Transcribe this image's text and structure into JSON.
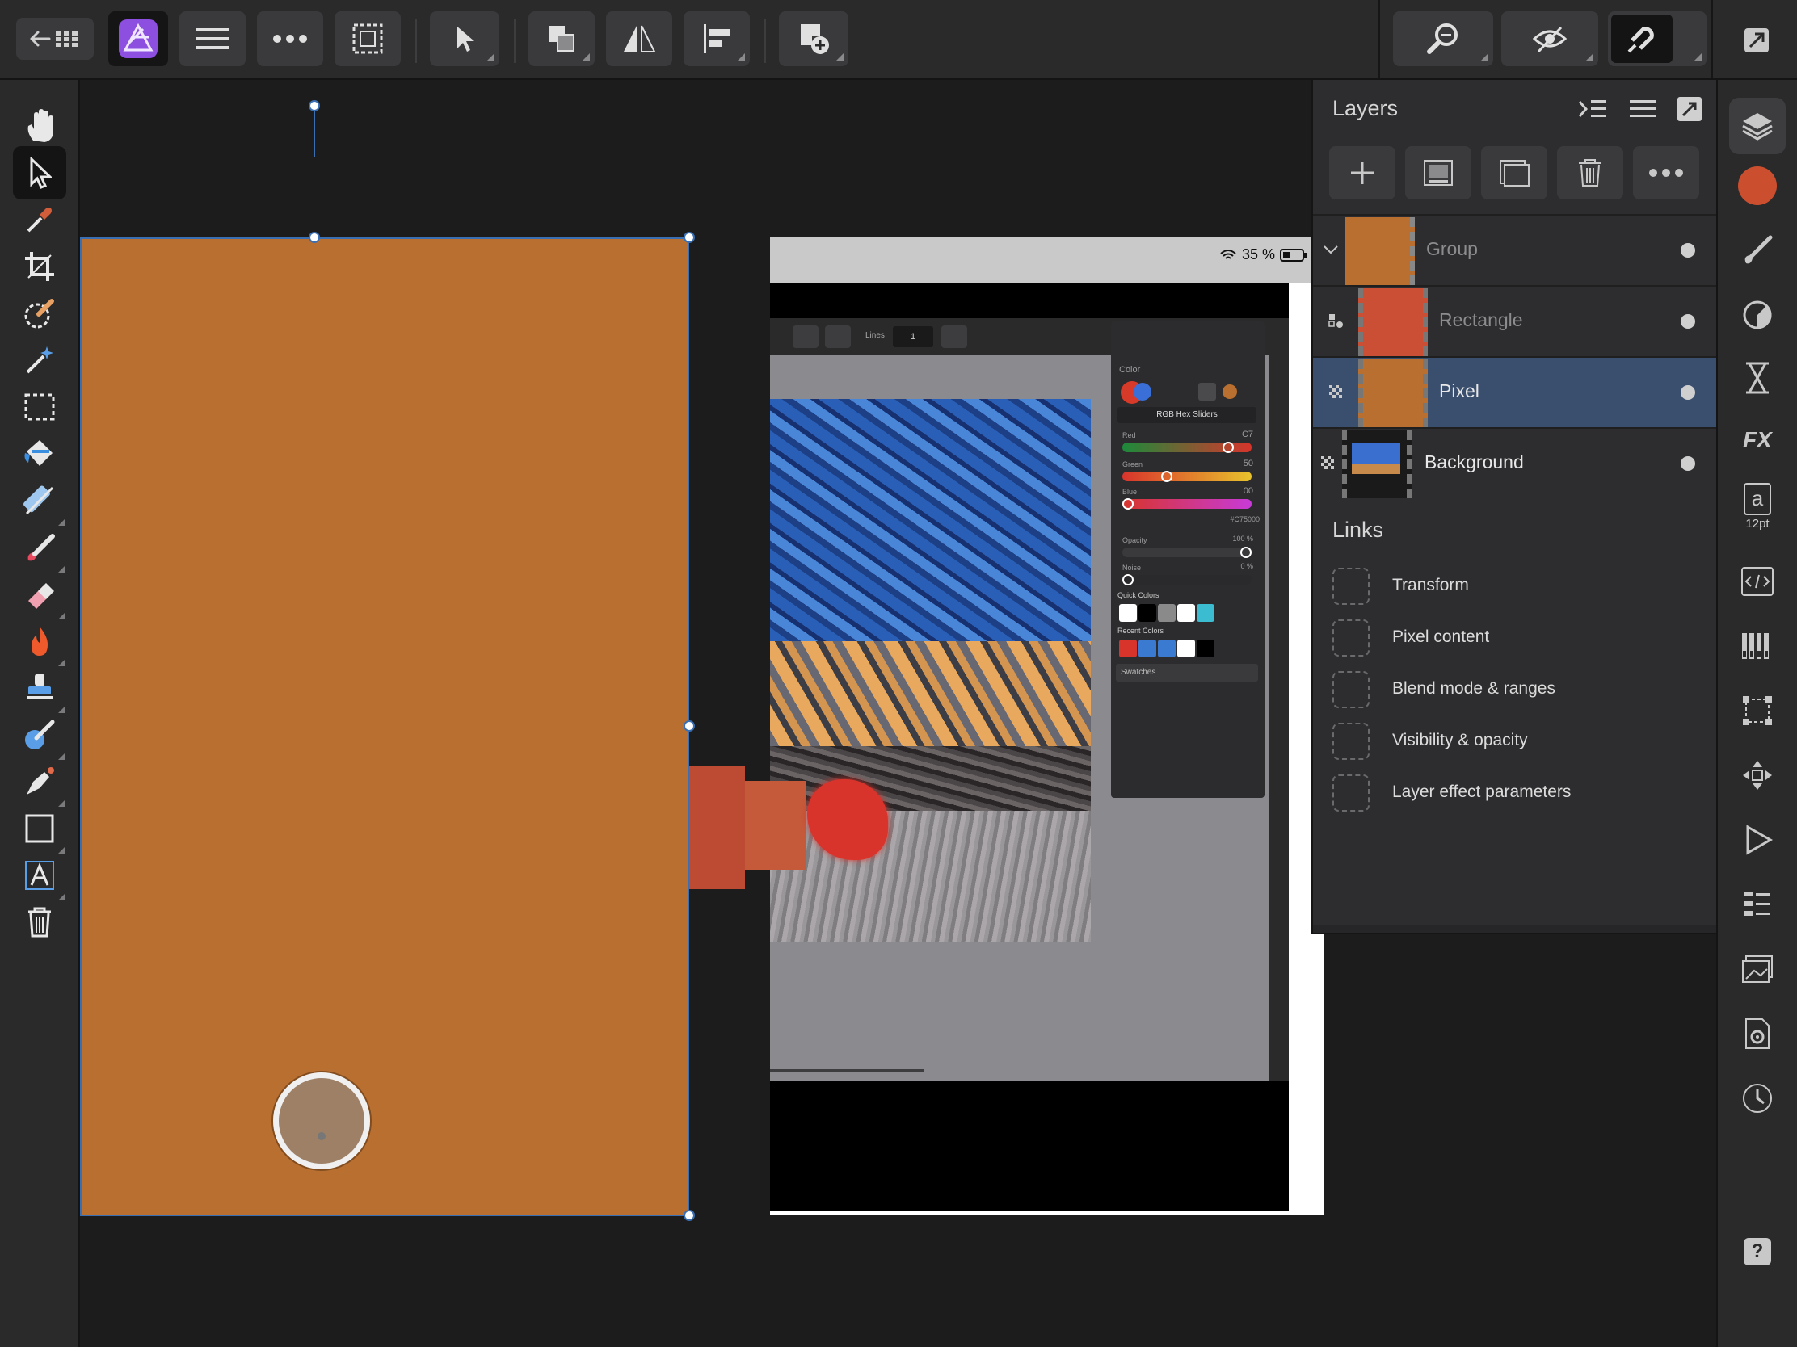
{
  "toolbar": {
    "back_label": "Back to gallery",
    "persona_name": "Photo Persona",
    "menu_label": "Menu",
    "more_label": "More",
    "selection_label": "Selection"
  },
  "canvas": {
    "screenshot": {
      "battery": "35 %",
      "lines_label": "Lines",
      "lines_value": "1",
      "color_panel": {
        "title": "Color",
        "mode": "RGB Hex Sliders",
        "red_label": "Red",
        "red_value": "C7",
        "green_label": "Green",
        "green_value": "50",
        "blue_label": "Blue",
        "blue_value": "00",
        "hex": "#C75000",
        "opacity_label": "Opacity",
        "opacity_value": "100 %",
        "noise_label": "Noise",
        "noise_value": "0 %",
        "quick_colors_label": "Quick Colors",
        "recent_colors_label": "Recent Colors",
        "swatches_label": "Swatches"
      }
    }
  },
  "layers_panel": {
    "title": "Layers",
    "layers": [
      {
        "name": "Group",
        "dimmed": true,
        "selected": false,
        "visible": true
      },
      {
        "name": "Rectangle",
        "dimmed": true,
        "selected": false,
        "visible": true
      },
      {
        "name": "Pixel",
        "dimmed": false,
        "selected": true,
        "visible": true
      },
      {
        "name": "Background",
        "dimmed": false,
        "selected": false,
        "visible": true
      }
    ],
    "links_title": "Links",
    "links": [
      {
        "label": "Transform"
      },
      {
        "label": "Pixel content"
      },
      {
        "label": "Blend mode & ranges"
      },
      {
        "label": "Visibility & opacity"
      },
      {
        "label": "Layer effect parameters"
      }
    ]
  },
  "rightbar": {
    "character_glyph": "a",
    "font_size": "12pt",
    "help_glyph": "?"
  },
  "colors": {
    "accent": "#3a6fb4",
    "primary_swatch": "#cb4f2e",
    "orange_fill": "#b96f2f",
    "persona_purple": "#8d4fe0"
  }
}
